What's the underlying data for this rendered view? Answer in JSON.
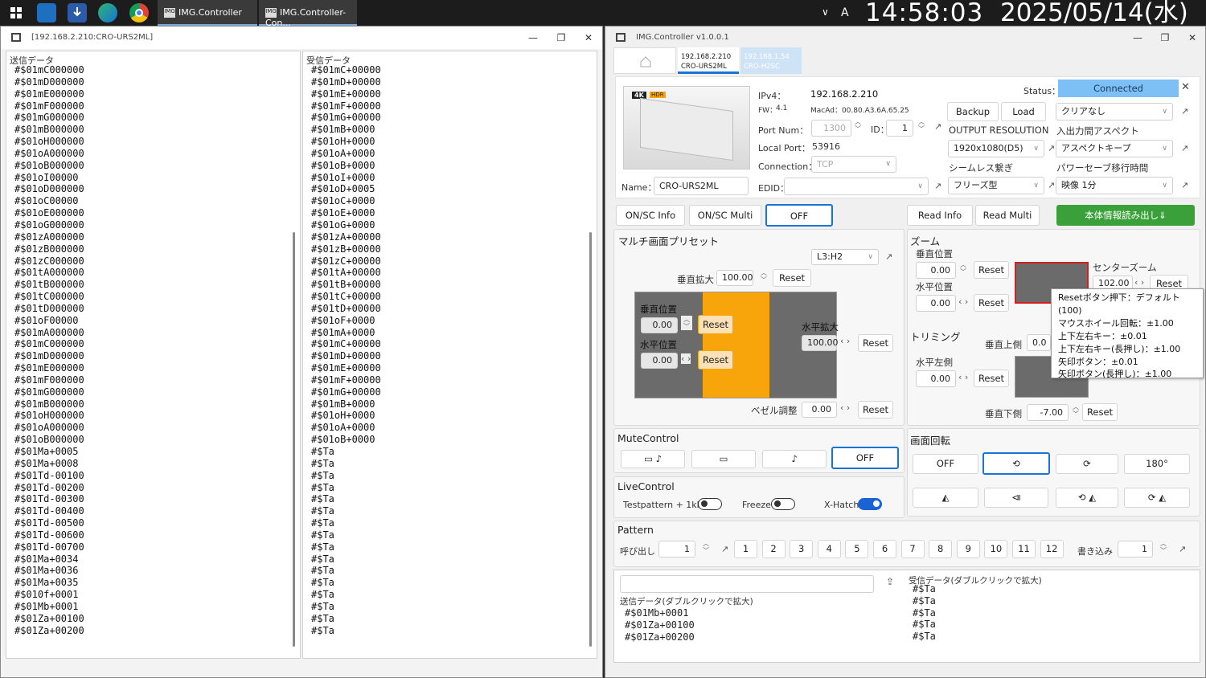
{
  "taskbar": {
    "tasks": [
      "IMG.Controller",
      "IMG.Controller-Con..."
    ],
    "ime": "A",
    "time": "14:58:03",
    "date": "2025/05/14(水)"
  },
  "left_window": {
    "title": "[192.168.2.210:CRO-URS2ML]",
    "send_caption": "送信データ",
    "recv_caption": "受信データ",
    "send_lines": [
      "#$01mC000000",
      "#$01mD000000",
      "#$01mE000000",
      "#$01mF000000",
      "#$01mG000000",
      "#$01mB000000",
      "#$01oH000000",
      "#$01oA000000",
      "#$01oB000000",
      "#$01oI00000",
      "#$01oD000000",
      "#$01oC00000",
      "#$01oE000000",
      "#$01oG000000",
      "#$01zA000000",
      "#$01zB000000",
      "#$01zC000000",
      "#$01tA000000",
      "#$01tB000000",
      "#$01tC000000",
      "#$01tD000000",
      "#$01oF00000",
      "#$01mA000000",
      "#$01mC000000",
      "#$01mD000000",
      "#$01mE000000",
      "#$01mF000000",
      "#$01mG000000",
      "#$01mB000000",
      "#$01oH000000",
      "#$01oA000000",
      "#$01oB000000",
      "#$01Ma+0005",
      "#$01Ma+0008",
      "#$01Td-00100",
      "#$01Td-00200",
      "#$01Td-00300",
      "#$01Td-00400",
      "#$01Td-00500",
      "#$01Td-00600",
      "#$01Td-00700",
      "#$01Ma+0034",
      "#$01Ma+0036",
      "#$01Ma+0035",
      "#$010f+0001",
      "#$01Mb+0001",
      "#$01Za+00100",
      "#$01Za+00200"
    ],
    "recv_lines": [
      "#$01mC+00000",
      "#$01mD+00000",
      "#$01mE+00000",
      "#$01mF+00000",
      "#$01mG+00000",
      "#$01mB+0000",
      "#$01oH+0000",
      "#$01oA+0000",
      "#$01oB+0000",
      "#$01oI+0000",
      "#$01oD+0005",
      "#$01oC+0000",
      "#$01oE+0000",
      "#$01oG+0000",
      "#$01zA+00000",
      "#$01zB+00000",
      "#$01zC+00000",
      "#$01tA+00000",
      "#$01tB+00000",
      "#$01tC+00000",
      "#$01tD+00000",
      "#$01oF+0000",
      "#$01mA+0000",
      "#$01mC+00000",
      "#$01mD+00000",
      "#$01mE+00000",
      "#$01mF+00000",
      "#$01mG+00000",
      "#$01mB+0000",
      "#$01oH+0000",
      "#$01oA+0000",
      "#$01oB+0000",
      "#$Ta",
      "#$Ta",
      "#$Ta",
      "#$Ta",
      "#$Ta",
      "#$Ta",
      "#$Ta",
      "#$Ta",
      "#$Ta",
      "#$Ta",
      "#$Ta",
      "#$Ta",
      "#$Ta",
      "#$Ta",
      "#$Ta",
      "#$Ta"
    ]
  },
  "right_window": {
    "title": "IMG.Controller v1.0.0.1",
    "tabs": [
      {
        "ip": "192.168.2.210",
        "model": "CRO-URS2ML"
      },
      {
        "ip": "192.168.1.54",
        "model": "CRO-H2SC"
      }
    ],
    "device": {
      "ipv4_label": "IPv4：",
      "ipv4": "192.168.2.210",
      "fw_label": "FW：",
      "fw": "4.1",
      "mac": "MacAd：00.80.A3.6A.65.25",
      "port_label": "Port Num：",
      "port": "1300",
      "id_label": "ID：",
      "id": "1",
      "local_port_label": "Local Port：",
      "local_port": "53916",
      "connection_label": "Connection：",
      "connection": "TCP",
      "name_label": "Name：",
      "name": "CRO-URS2ML",
      "edid_label": "EDID：",
      "edid": "",
      "status_label": "Status：",
      "status": "Connected",
      "backup": "Backup",
      "load": "Load",
      "preset": "クリアなし",
      "output_res_label": "OUTPUT RESOLUTION",
      "output_res": "1920x1080(D5)",
      "aspect_label": "入出力間アスペクト",
      "aspect": "アスペクトキープ",
      "seamless_label": "シームレス繋ぎ",
      "seamless": "フリーズ型",
      "powersave_label": "パワーセーブ移行時間",
      "powersave": "映像 1分",
      "logo_badges": [
        "4K",
        "HDR"
      ]
    },
    "row_buttons": {
      "onsc_info": "ON/SC Info",
      "onsc_multi": "ON/SC Multi",
      "off": "OFF",
      "read_info": "Read Info",
      "read_multi": "Read Multi",
      "read_device": "本体情報読み出し⇓"
    },
    "multi_preset": {
      "title": "マルチ画面プリセット",
      "layout": "L3:H2",
      "v_zoom_label": "垂直拡大",
      "v_zoom": "100.00",
      "v_pos_label": "垂直位置",
      "v_pos": "0.00",
      "h_pos_label": "水平位置",
      "h_pos": "0.00",
      "h_zoom_label": "水平拡大",
      "h_zoom": "100.00",
      "bezel_label": "ベゼル調整",
      "bezel": "0.00",
      "reset": "Reset"
    },
    "zoom": {
      "title": "ズーム",
      "v_pos_label": "垂直位置",
      "v_pos": "0.00",
      "h_pos_label": "水平位置",
      "h_pos": "0.00",
      "center_label": "センターズーム",
      "center": "102.00",
      "reset": "Reset"
    },
    "trimming": {
      "title": "トリミング",
      "top_label": "垂直上側",
      "top": "0.0",
      "left_label": "水平左側",
      "left": "0.00",
      "bottom_label": "垂直下側",
      "bottom": "-7.00",
      "reset": "Reset"
    },
    "tooltip": [
      "Resetボタン押下：デフォルト(100)",
      "マウスホイール回転：±1.00",
      "上下左右キー：±0.01",
      "上下左右キー(長押し)：±1.00",
      "矢印ボタン：±0.01",
      "矢印ボタン(長押し)：±1.00"
    ],
    "mute": {
      "title": "MuteControl",
      "off": "OFF"
    },
    "rotation": {
      "title": "画面回転",
      "off": "OFF",
      "r180": "180°"
    },
    "live": {
      "title": "LiveControl",
      "testpattern": "Testpattern + 1khz",
      "freeze": "Freeze",
      "xhatch": "X-Hatch",
      "testpattern_on": false,
      "freeze_on": false,
      "xhatch_on": true
    },
    "pattern": {
      "title": "Pattern",
      "call_label": "呼び出し",
      "call": "1",
      "numbers": [
        "1",
        "2",
        "3",
        "4",
        "5",
        "6",
        "7",
        "8",
        "9",
        "10",
        "11",
        "12"
      ],
      "write_label": "書き込み",
      "write": "1"
    },
    "console": {
      "send_caption": "送信データ(ダブルクリックで拡大)",
      "send_lines": [
        "#$01Mb+0001",
        "#$01Za+00100",
        "#$01Za+00200"
      ],
      "recv_caption": "受信データ(ダブルクリックで拡大)",
      "recv_lines": [
        "#$Ta",
        "#$Ta",
        "#$Ta",
        "#$Ta",
        "#$Ta"
      ]
    }
  },
  "colors": {
    "accent_blue": "#7cc0f5",
    "green": "#3aa03a",
    "orange": "#f7a50a",
    "gray_panel": "#6b6b6b",
    "red_border": "#d21f1f"
  }
}
